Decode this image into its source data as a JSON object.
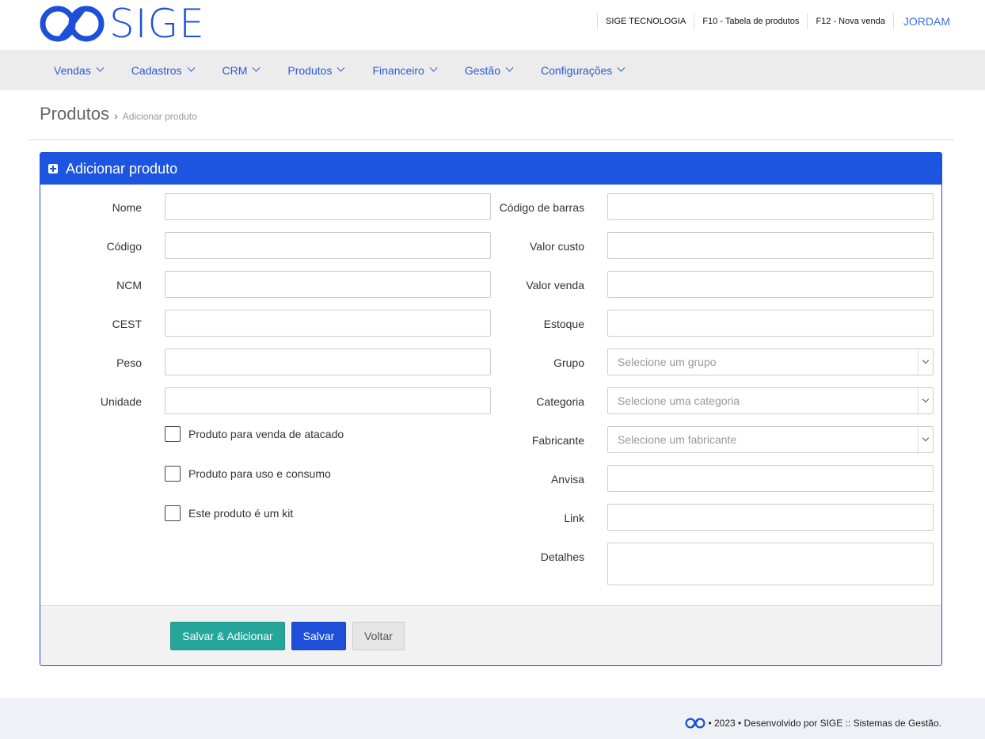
{
  "brand": {
    "name": "SIGE",
    "color": "#1d4fd8"
  },
  "header": {
    "links": [
      "SIGE TECNOLOGIA",
      "F10 - Tabela de produtos",
      "F12 - Nova venda"
    ],
    "user": "JORDAM"
  },
  "menu": [
    {
      "label": "Vendas"
    },
    {
      "label": "Cadastros"
    },
    {
      "label": "CRM"
    },
    {
      "label": "Produtos"
    },
    {
      "label": "Financeiro"
    },
    {
      "label": "Gestão"
    },
    {
      "label": "Configurações"
    }
  ],
  "breadcrumb": {
    "main": "Produtos",
    "separator": "›",
    "sub": "Adicionar produto"
  },
  "panel": {
    "title": "Adicionar produto",
    "left_fields": {
      "nome": {
        "label": "Nome",
        "value": ""
      },
      "codigo": {
        "label": "Código",
        "value": ""
      },
      "ncm": {
        "label": "NCM",
        "value": ""
      },
      "cest": {
        "label": "CEST",
        "value": ""
      },
      "peso": {
        "label": "Peso",
        "value": ""
      },
      "unidade": {
        "label": "Unidade",
        "value": ""
      }
    },
    "checkboxes": {
      "atacado": {
        "label": "Produto para venda de atacado",
        "checked": false
      },
      "consumo": {
        "label": "Produto para uso e consumo",
        "checked": false
      },
      "kit": {
        "label": "Este produto é um kit",
        "checked": false
      }
    },
    "right_fields": {
      "codigo_barras": {
        "label": "Código de barras",
        "value": ""
      },
      "valor_custo": {
        "label": "Valor custo",
        "value": ""
      },
      "valor_venda": {
        "label": "Valor venda",
        "value": ""
      },
      "estoque": {
        "label": "Estoque",
        "value": ""
      },
      "grupo": {
        "label": "Grupo",
        "placeholder": "Selecione um grupo"
      },
      "categoria": {
        "label": "Categoria",
        "placeholder": "Selecione uma categoria"
      },
      "fabricante": {
        "label": "Fabricante",
        "placeholder": "Selecione um fabricante"
      },
      "anvisa": {
        "label": "Anvisa",
        "value": ""
      },
      "link": {
        "label": "Link",
        "value": ""
      },
      "detalhes": {
        "label": "Detalhes",
        "value": ""
      }
    },
    "buttons": {
      "save_add": "Salvar & Adicionar",
      "save": "Salvar",
      "back": "Voltar"
    }
  },
  "footer": {
    "text": "• 2023 • Desenvolvido por SIGE :: Sistemas de Gestão."
  },
  "colors": {
    "primary": "#1d55e0",
    "success": "#26a69a",
    "menu_bg": "#ececec",
    "footer_bg": "#eef1f6"
  }
}
